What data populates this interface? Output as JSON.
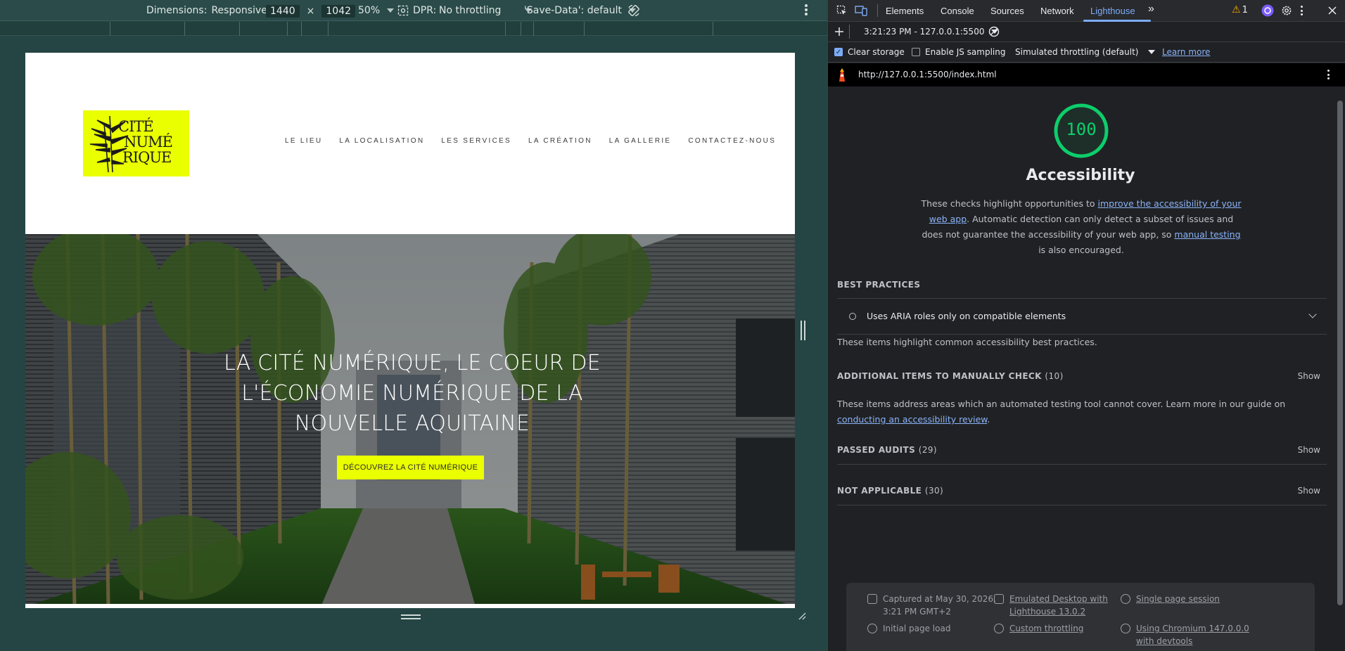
{
  "device_toolbar": {
    "dimensions_label": "Dimensions:",
    "dimensions_value": "Responsive",
    "width": "1440",
    "times": "×",
    "height": "1042",
    "zoom": "50%",
    "dpr_label": "DPR:",
    "throttling": "No throttling",
    "save_data": "'Save-Data': default"
  },
  "site": {
    "logo_lines": [
      "CITÉ",
      "NUMÉ",
      "RIQUE"
    ],
    "nav": [
      "LE LIEU",
      "LA LOCALISATION",
      "LES SERVICES",
      "LA CRÉATION",
      "LA GALLERIE",
      "CONTACTEZ-NOUS"
    ],
    "hero_title": "LA CITÉ NUMÉRIQUE, LE COEUR DE L'ÉCONOMIE NUMÉRIQUE DE LA NOUVELLE AQUITAINE",
    "hero_cta": "DÉCOUVREZ LA CITÉ NUMÉRIQUE"
  },
  "devtools": {
    "tabs": [
      "Elements",
      "Console",
      "Sources",
      "Network",
      "Lighthouse"
    ],
    "active_tab": "Lighthouse",
    "more_tabs": "»",
    "warning_count": "1",
    "report_time": "3:21:23 PM - 127.0.0.1:5500",
    "clear_storage": "Clear storage",
    "clear_storage_checked": true,
    "js_sampling": "Enable JS sampling",
    "js_sampling_checked": false,
    "throttling_mode": "Simulated throttling (default)",
    "learn_more": "Learn more",
    "url": "http://127.0.0.1:5500/index.html"
  },
  "report": {
    "score": "100",
    "category": "Accessibility",
    "desc_1": "These checks highlight opportunities to ",
    "desc_link_1": "improve the accessibility of your web app",
    "desc_2": ". Automatic detection can only detect a subset of issues and does not guarantee the accessibility of your web app, so ",
    "desc_link_2": "manual testing",
    "desc_3": " is also encouraged.",
    "best_practices_title": "BEST PRACTICES",
    "audit_label": "Uses ARIA roles only on compatible elements",
    "best_practices_note": "These items highlight common accessibility best practices.",
    "manual_title": "ADDITIONAL ITEMS TO MANUALLY CHECK",
    "manual_count": "(10)",
    "manual_note_1": "These items address areas which an automated testing tool cannot cover. Learn more in our guide on ",
    "manual_note_link": "conducting an accessibility review",
    "manual_note_2": ".",
    "passed_title": "PASSED AUDITS",
    "passed_count": "(29)",
    "na_title": "NOT APPLICABLE",
    "na_count": "(30)",
    "show": "Show",
    "footer": {
      "captured_1": "Captured at May 30, 2026,",
      "captured_2": "3:21 PM GMT+2",
      "initial_load": "Initial page load",
      "emulated_1": "Emulated Desktop with",
      "emulated_2": "Lighthouse 13.0.2",
      "custom_throttling": "Custom throttling",
      "single_session": "Single page session",
      "chromium_1": "Using Chromium 147.0.0.0",
      "chromium_2": "with devtools"
    }
  },
  "colors": {
    "accent_yellow": "#eaff00",
    "score_green": "#0cce6b",
    "devtools_blue": "#7cacf8",
    "devtools_bg": "#202124"
  }
}
